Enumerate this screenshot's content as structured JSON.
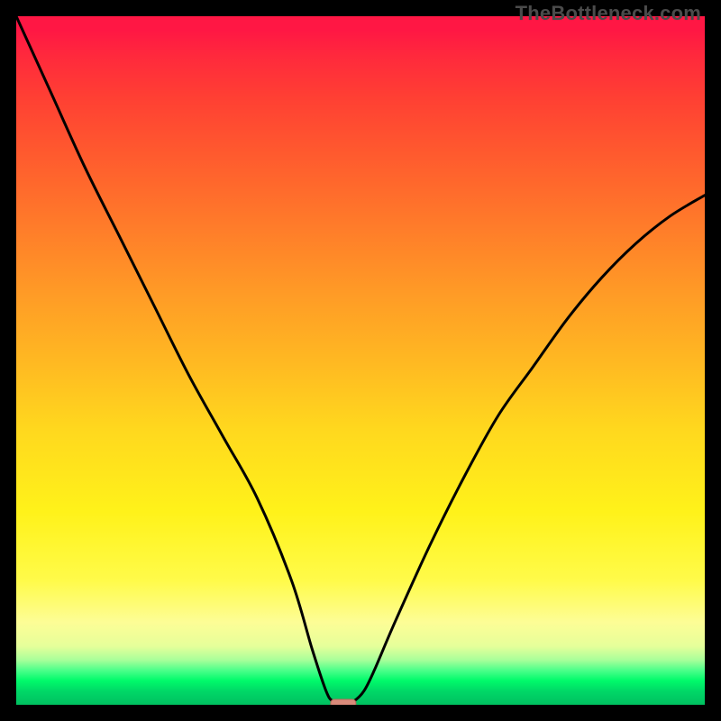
{
  "watermark": {
    "text": "TheBottleneck.com"
  },
  "colors": {
    "frame": "#000000",
    "curve": "#000000",
    "marker_fill": "#d98a7a",
    "marker_stroke": "#b86a5a",
    "gradient_top": "#ff1744",
    "gradient_bottom": "#00c060"
  },
  "chart_data": {
    "type": "line",
    "title": "",
    "xlabel": "",
    "ylabel": "",
    "xlim": [
      0,
      100
    ],
    "ylim": [
      0,
      100
    ],
    "grid": false,
    "legend": false,
    "series": [
      {
        "name": "bottleneck-curve",
        "x": [
          0,
          5,
          10,
          15,
          20,
          25,
          30,
          35,
          40,
          43,
          45,
          46,
          47.5,
          49,
          50.5,
          52,
          55,
          60,
          65,
          70,
          75,
          80,
          85,
          90,
          95,
          100
        ],
        "y": [
          100,
          89,
          78,
          68,
          58,
          48,
          39,
          30,
          18,
          8,
          2,
          0.5,
          0,
          0.5,
          2,
          5,
          12,
          23,
          33,
          42,
          49,
          56,
          62,
          67,
          71,
          74
        ]
      }
    ],
    "marker": {
      "x": 47.5,
      "y": 0,
      "shape": "rounded-rect"
    }
  }
}
